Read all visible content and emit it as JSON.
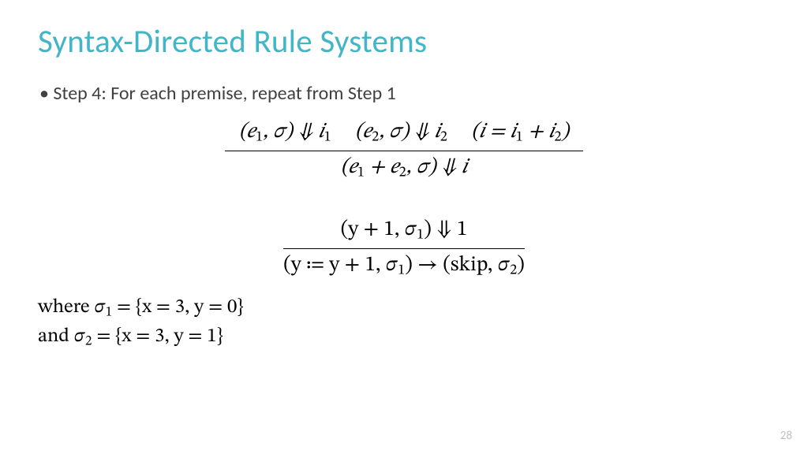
{
  "title": "Syntax-Directed Rule Systems",
  "bullet": "Step 4: For each premise, repeat from Step 1",
  "rule1": {
    "p1a": "(𝑒",
    "p1b": ", 𝜎) ⇓ 𝑖",
    "p2a": "(𝑒",
    "p2b": ", 𝜎) ⇓ 𝑖",
    "p3a": "(𝑖 = 𝑖",
    "p3b": " + 𝑖",
    "p3c": ")",
    "concA": "(𝑒",
    "concB": " + 𝑒",
    "concC": ", 𝜎) ⇓ 𝑖",
    "s1": "1",
    "s2": "2"
  },
  "rule2": {
    "premA": "(y + 1, 𝜎",
    "premB": ") ⇓ 1",
    "concA": "(y ≔ y + 1, 𝜎",
    "concB": ") → (skip, 𝜎",
    "concC": ")",
    "s1": "1",
    "s2": "2"
  },
  "where": {
    "l1a": "where 𝜎",
    "l1b": " = {x = 3, y = 0}",
    "l2a": "and 𝜎",
    "l2b": " = {x = 3, y = 1}",
    "s1": "1",
    "s2": "2"
  },
  "page": "28"
}
